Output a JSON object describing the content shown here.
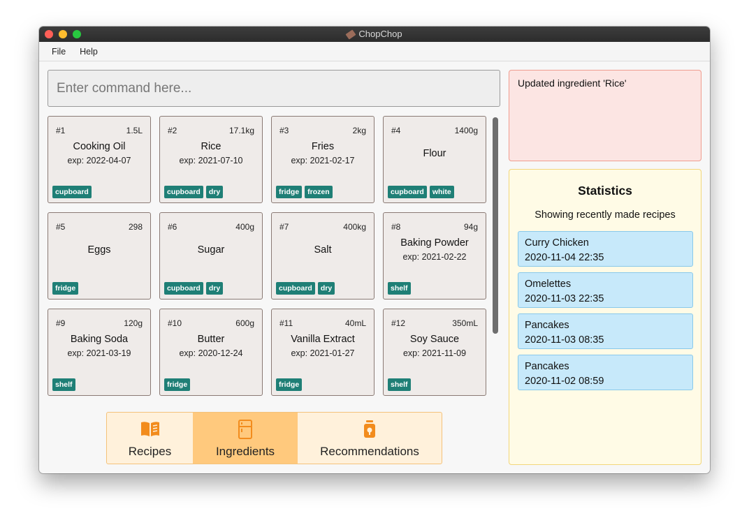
{
  "window": {
    "title": "ChopChop"
  },
  "menu": [
    "File",
    "Help"
  ],
  "command": {
    "placeholder": "Enter command here..."
  },
  "ingredients": [
    {
      "index": "#1",
      "quantity": "1.5L",
      "name": "Cooking Oil",
      "expiry": "exp: 2022-04-07",
      "tags": [
        "cupboard"
      ]
    },
    {
      "index": "#2",
      "quantity": "17.1kg",
      "name": "Rice",
      "expiry": "exp: 2021-07-10",
      "tags": [
        "cupboard",
        "dry"
      ]
    },
    {
      "index": "#3",
      "quantity": "2kg",
      "name": "Fries",
      "expiry": "exp: 2021-02-17",
      "tags": [
        "fridge",
        "frozen"
      ]
    },
    {
      "index": "#4",
      "quantity": "1400g",
      "name": "Flour",
      "expiry": "",
      "tags": [
        "cupboard",
        "white"
      ]
    },
    {
      "index": "#5",
      "quantity": "298",
      "name": "Eggs",
      "expiry": "",
      "tags": [
        "fridge"
      ]
    },
    {
      "index": "#6",
      "quantity": "400g",
      "name": "Sugar",
      "expiry": "",
      "tags": [
        "cupboard",
        "dry"
      ]
    },
    {
      "index": "#7",
      "quantity": "400kg",
      "name": "Salt",
      "expiry": "",
      "tags": [
        "cupboard",
        "dry"
      ]
    },
    {
      "index": "#8",
      "quantity": "94g",
      "name": "Baking Powder",
      "expiry": "exp: 2021-02-22",
      "tags": [
        "shelf"
      ]
    },
    {
      "index": "#9",
      "quantity": "120g",
      "name": "Baking Soda",
      "expiry": "exp: 2021-03-19",
      "tags": [
        "shelf"
      ]
    },
    {
      "index": "#10",
      "quantity": "600g",
      "name": "Butter",
      "expiry": "exp: 2020-12-24",
      "tags": [
        "fridge"
      ]
    },
    {
      "index": "#11",
      "quantity": "40mL",
      "name": "Vanilla Extract",
      "expiry": "exp: 2021-01-27",
      "tags": [
        "fridge"
      ]
    },
    {
      "index": "#12",
      "quantity": "350mL",
      "name": "Soy Sauce",
      "expiry": "exp: 2021-11-09",
      "tags": [
        "shelf"
      ]
    }
  ],
  "tabs": [
    {
      "label": "Recipes",
      "icon": "book-icon",
      "active": false
    },
    {
      "label": "Ingredients",
      "icon": "fridge-icon",
      "active": true
    },
    {
      "label": "Recommendations",
      "icon": "lightbulb-icon",
      "active": false
    }
  ],
  "feedback": {
    "message": "Updated ingredient 'Rice'"
  },
  "statistics": {
    "title": "Statistics",
    "subtitle": "Showing recently made recipes",
    "items": [
      {
        "name": "Curry Chicken",
        "time": "2020-11-04 22:35"
      },
      {
        "name": "Omelettes",
        "time": "2020-11-03 22:35"
      },
      {
        "name": "Pancakes",
        "time": "2020-11-03 08:35"
      },
      {
        "name": "Pancakes",
        "time": "2020-11-02 08:59"
      }
    ]
  },
  "colors": {
    "tag": "#1f7f76",
    "tab_active": "#ffc97d",
    "tab_bg": "#fff1db",
    "icon_accent": "#f28c1d",
    "feedback_bg": "#fce5e3",
    "stats_bg": "#fffbe6",
    "stat_item_bg": "#c7e9fa"
  }
}
